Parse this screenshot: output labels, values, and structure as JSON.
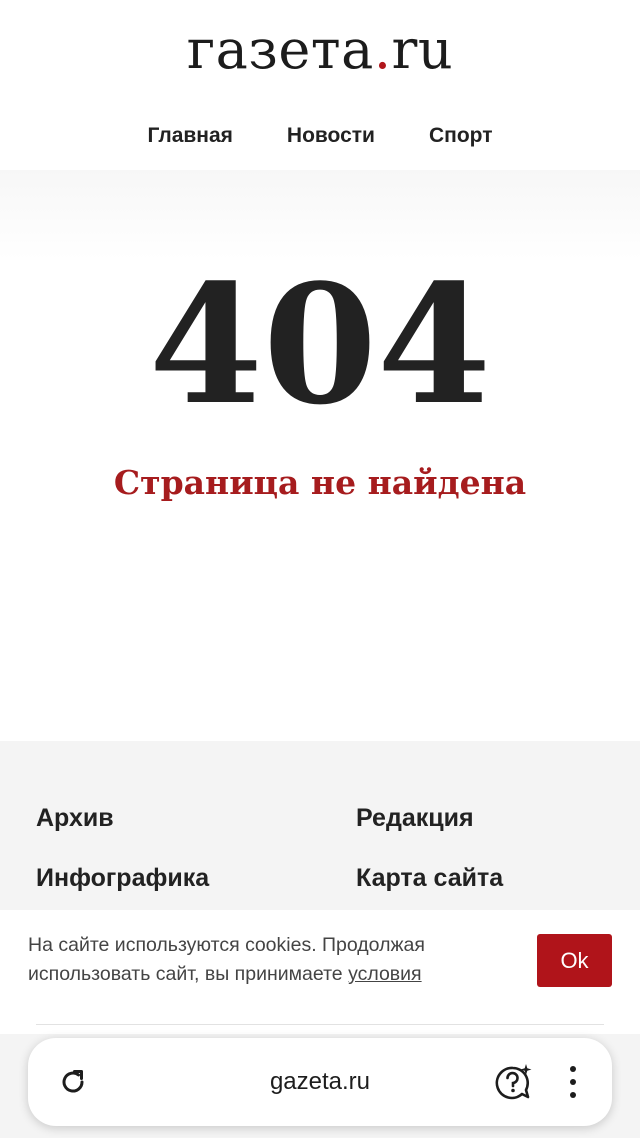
{
  "header": {
    "logo_main": "газета",
    "logo_dot": ".",
    "logo_tld": "ru",
    "nav": [
      "Главная",
      "Новости",
      "Спорт"
    ]
  },
  "error": {
    "code": "404",
    "message": "Страница не найдена"
  },
  "footer": {
    "links": [
      "Архив",
      "Редакция",
      "Инфографика",
      "Карта сайта"
    ]
  },
  "cookie_banner": {
    "text": "На сайте используются cookies. Продолжая использовать сайт, вы принимаете ",
    "link": "условия",
    "ok_label": "Ok"
  },
  "browser": {
    "url": "gazeta.ru",
    "icons": [
      "reload-icon",
      "assistant-icon",
      "more-menu-icon"
    ]
  },
  "colors": {
    "brand_red": "#b0141a",
    "heading_red": "#a61c1e",
    "text_dark": "#222222",
    "footer_bg": "#f4f4f4"
  }
}
